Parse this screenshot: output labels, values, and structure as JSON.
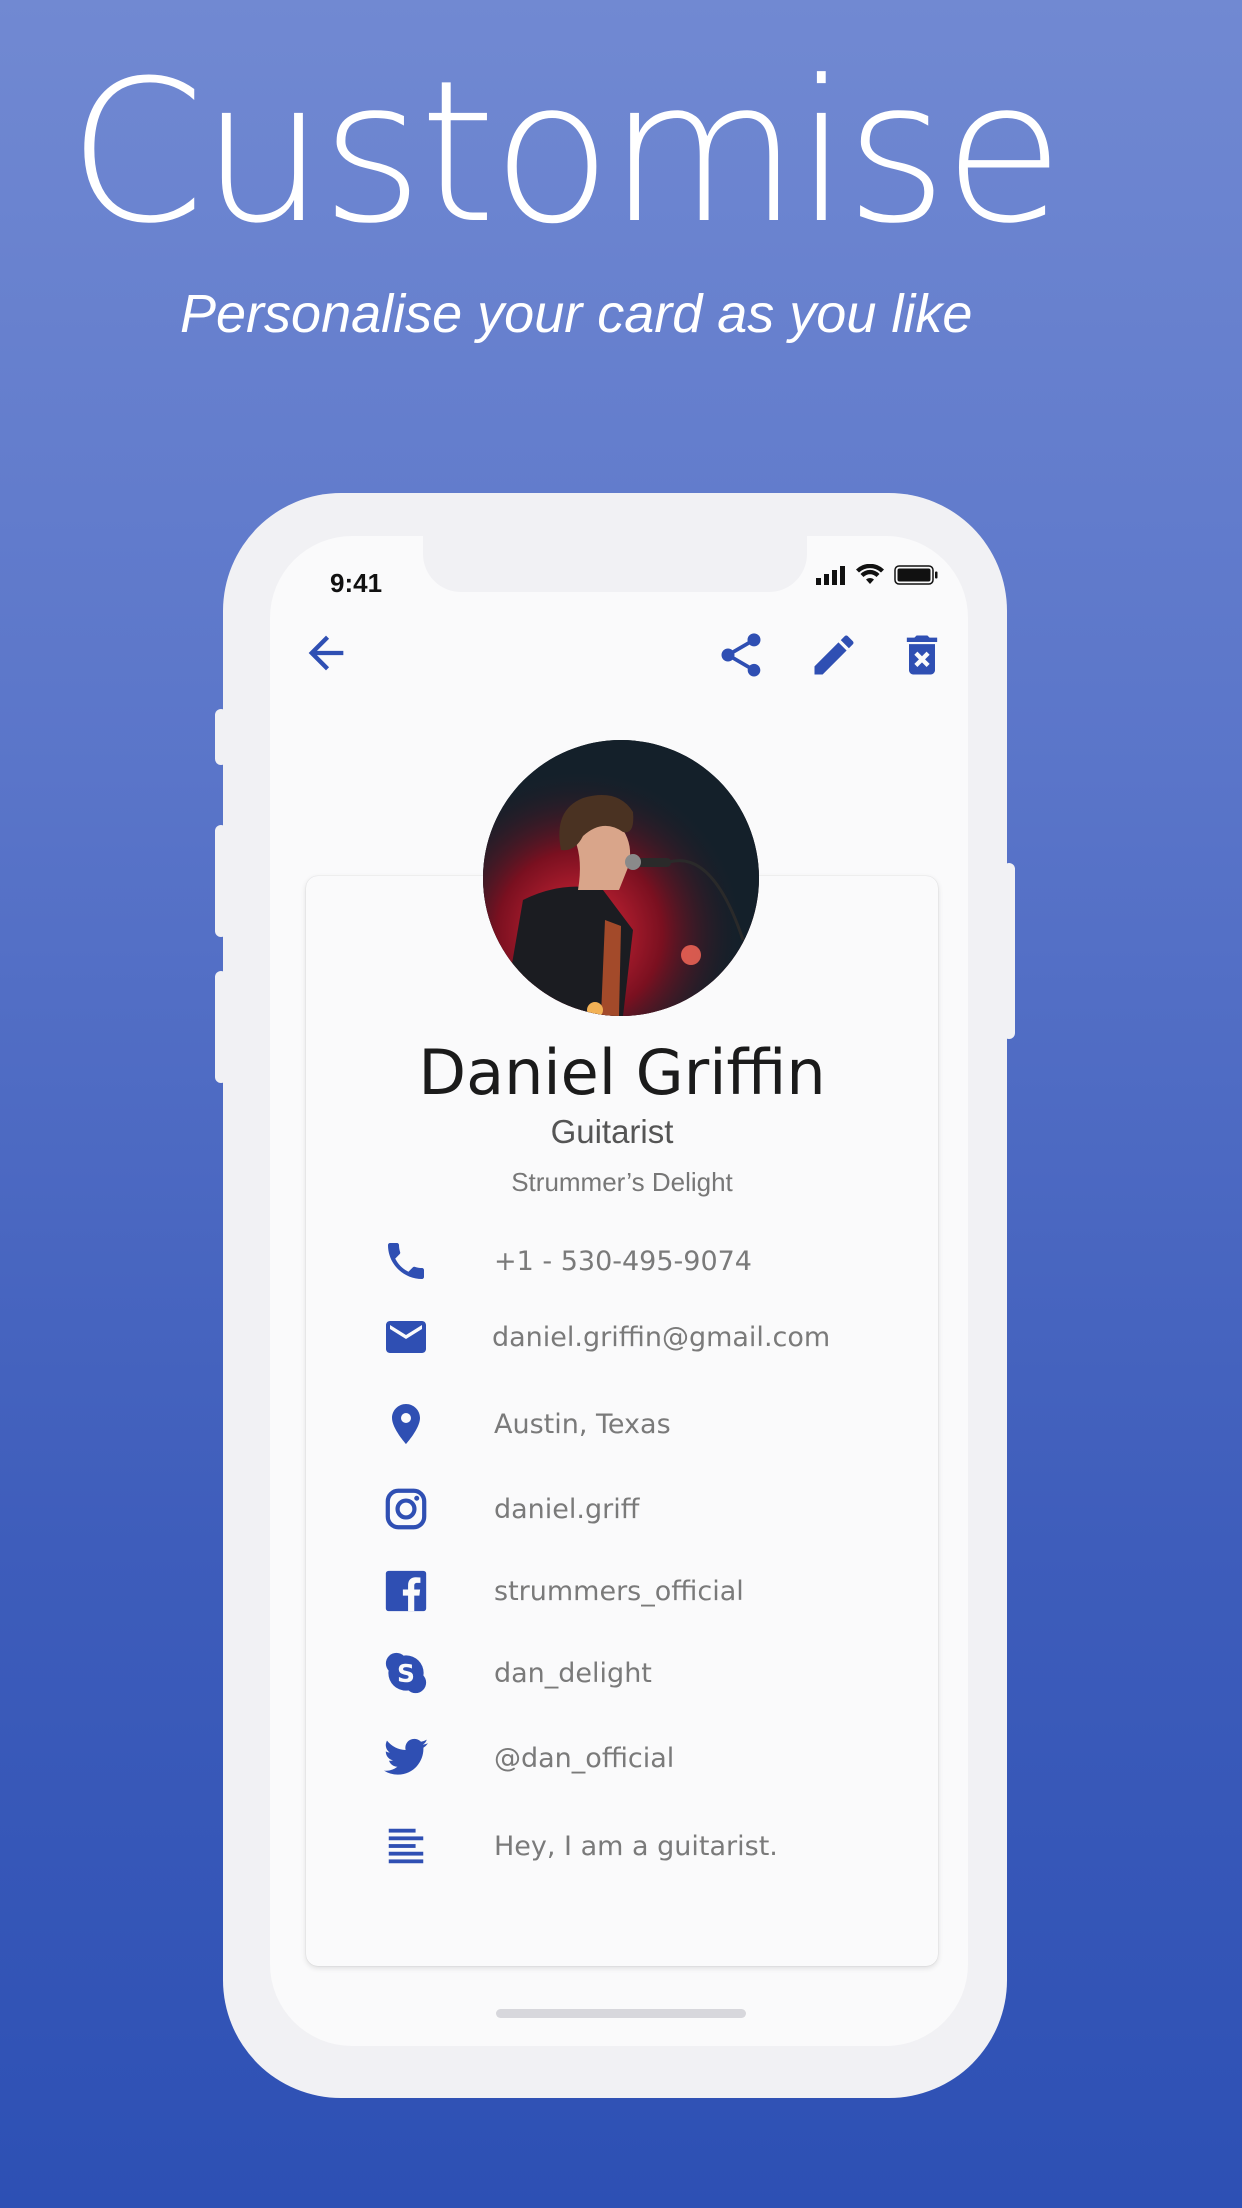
{
  "hero": {
    "title": "Customise",
    "subtitle": "Personalise your card as you like"
  },
  "status_bar": {
    "time": "9:41"
  },
  "toolbar": {
    "back_icon": "arrow-back-icon",
    "actions": [
      "share-icon",
      "edit-icon",
      "delete-icon"
    ]
  },
  "profile": {
    "name": "Daniel Griffin",
    "title": "Guitarist",
    "company": "Strummer’s Delight",
    "avatar": "photo of guitarist singing into microphone"
  },
  "contacts": [
    {
      "icon": "phone-icon",
      "value": "+1 - 530-495-9074"
    },
    {
      "icon": "email-icon",
      "value": "daniel.griffin@gmail.com"
    },
    {
      "icon": "location-icon",
      "value": "Austin, Texas"
    },
    {
      "icon": "instagram-icon",
      "value": "daniel.griff"
    },
    {
      "icon": "facebook-icon",
      "value": "strummers_official"
    },
    {
      "icon": "skype-icon",
      "value": "dan_delight"
    },
    {
      "icon": "twitter-icon",
      "value": "@dan_official"
    },
    {
      "icon": "notes-icon",
      "value": "Hey, I am a guitarist."
    }
  ],
  "colors": {
    "accent": "#2f4fb3",
    "background_top": "#7189d2",
    "background_bottom": "#2d50b4"
  }
}
